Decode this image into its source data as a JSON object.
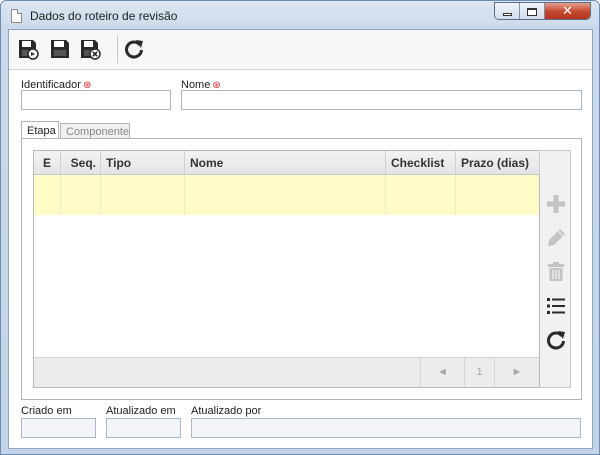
{
  "window": {
    "title": "Dados do roteiro de revisão",
    "close_glyph": "✕"
  },
  "toolbar": {
    "buttons": [
      {
        "icon": "save-new-icon"
      },
      {
        "icon": "save-icon"
      },
      {
        "icon": "save-close-icon"
      },
      {
        "icon": "refresh-icon"
      }
    ]
  },
  "fields": {
    "identificador_label": "Identificador",
    "identificador_value": "",
    "nome_label": "Nome",
    "nome_value": "",
    "required_marker": "⊛"
  },
  "tabs": [
    {
      "label": "Etapa",
      "active": true
    },
    {
      "label": "Componente",
      "active": false
    }
  ],
  "grid": {
    "columns": [
      "E",
      "Seq.",
      "Tipo",
      "Nome",
      "Checklist",
      "Prazo (dias)"
    ],
    "rows": [
      {
        "E": "",
        "Seq.": "",
        "Tipo": "",
        "Nome": "",
        "Checklist": "",
        "Prazo (dias)": ""
      }
    ],
    "highlight_color": "#fffcc8",
    "pager": {
      "prev": "◄",
      "page": "1",
      "next": "►"
    }
  },
  "side_actions": [
    {
      "icon": "add-icon",
      "enabled": false
    },
    {
      "icon": "edit-icon",
      "enabled": false
    },
    {
      "icon": "delete-icon",
      "enabled": false
    },
    {
      "icon": "list-icon",
      "enabled": true
    },
    {
      "icon": "refresh-icon",
      "enabled": true
    }
  ],
  "footer": {
    "criado_em_label": "Criado em",
    "criado_em_value": "",
    "atualizado_em_label": "Atualizado em",
    "atualizado_em_value": "",
    "atualizado_por_label": "Atualizado por",
    "atualizado_por_value": ""
  }
}
